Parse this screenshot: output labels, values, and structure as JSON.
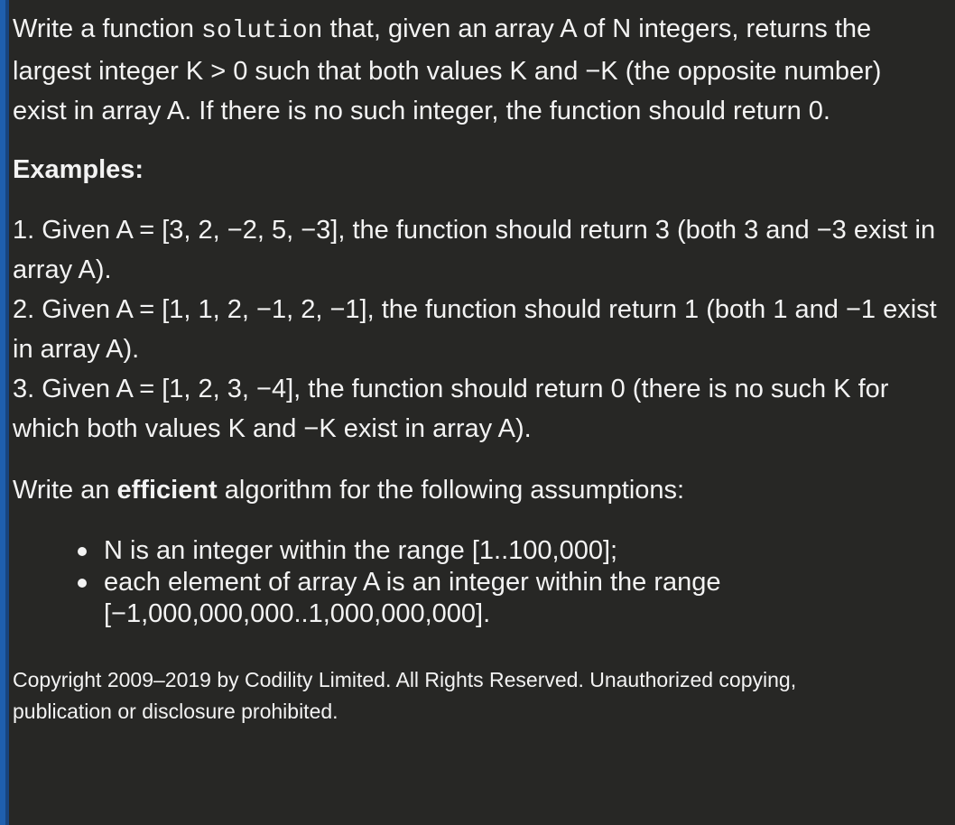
{
  "problem": {
    "intro_prefix": "Write a function ",
    "function_name": "solution",
    "intro_suffix": " that, given an array A of N integers, returns the largest integer K > 0 such that both values K and −K (the opposite number) exist in array A. If there is no such integer, the function should return 0."
  },
  "examples_heading": "Examples:",
  "examples": [
    "1. Given A = [3, 2, −2, 5, −3], the function should return 3 (both 3 and −3 exist in array A).",
    "2. Given A = [1, 1, 2, −1, 2, −1], the function should return 1 (both 1 and −1 exist in array A).",
    "3. Given A = [1, 2, 3, −4], the function should return 0 (there is no such K for which both values K and −K exist in array A)."
  ],
  "assumptions": {
    "prefix": "Write an ",
    "emphasis": "efficient",
    "suffix": " algorithm for the following assumptions:",
    "items": [
      "N is an integer within the range [1..100,000];",
      "each element of array A is an integer within the range [−1,000,000,000..1,000,000,000]."
    ]
  },
  "copyright": "Copyright 2009–2019 by Codility Limited. All Rights Reserved. Unauthorized copying, publication or disclosure prohibited.",
  "colors": {
    "background": "#272725",
    "text": "#f3f3f3",
    "accent": "#1f5fae"
  }
}
